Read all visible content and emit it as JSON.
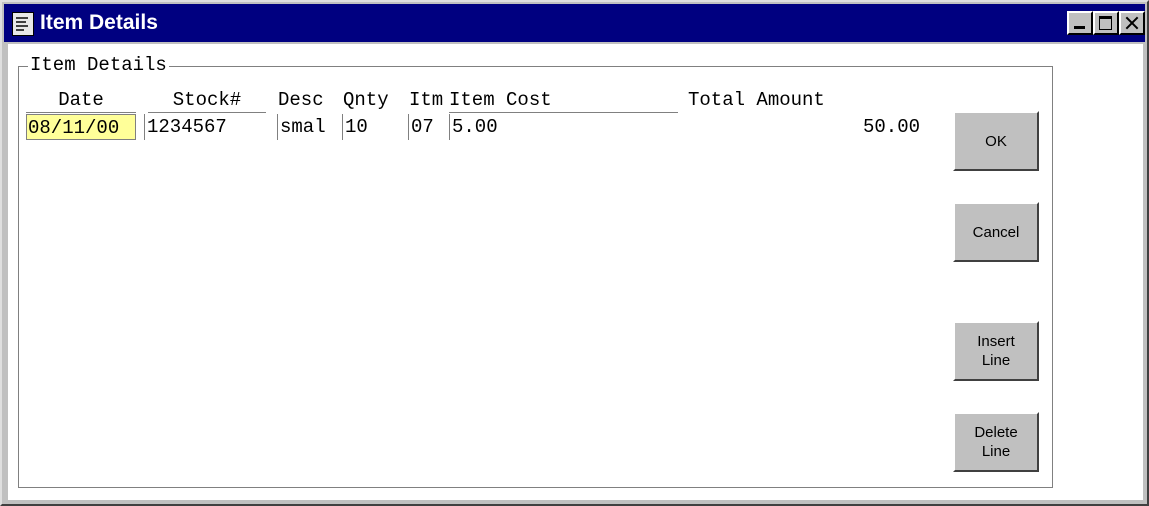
{
  "window": {
    "title": "Item Details",
    "icon": "document-icon"
  },
  "group": {
    "label": "Item Details"
  },
  "columns": {
    "date": "Date",
    "stock": "Stock#",
    "desc": "Desc",
    "qnty": "Qnty",
    "itm": "Itm",
    "item_cost": "Item Cost",
    "total_amount": "Total Amount"
  },
  "row": {
    "date": "08/11/00",
    "stock": "1234567",
    "desc": "smal",
    "qnty": "10",
    "itm": "07",
    "item_cost": "5.00",
    "total_amount": "50.00"
  },
  "buttons": {
    "ok": "OK",
    "cancel": "Cancel",
    "insert_line": "Insert\nLine",
    "delete_line": "Delete\nLine"
  },
  "colors": {
    "title_bar": "#000080",
    "window_face": "#c0c0c0",
    "date_highlight": "#ffff99"
  }
}
